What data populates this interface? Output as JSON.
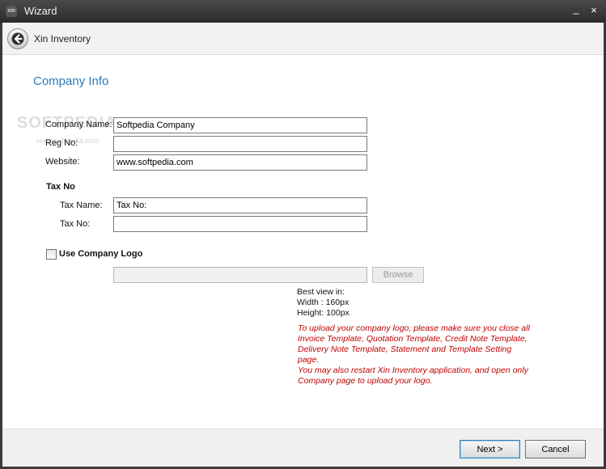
{
  "window": {
    "title": "Wizard",
    "app_icon_text": "xin",
    "minimize": "_",
    "close": "×"
  },
  "nav": {
    "title": "Xin Inventory"
  },
  "page": {
    "title": "Company Info",
    "watermark": "SOFTPEDIA",
    "watermark_url": "www.softpedia.com"
  },
  "form": {
    "company_name": {
      "label": "Company Name:",
      "value": "Softpedia Company"
    },
    "reg_no": {
      "label": "Reg No:",
      "value": ""
    },
    "website": {
      "label": "Website:",
      "value": "www.softpedia.com"
    },
    "tax_section": "Tax No",
    "tax_name": {
      "label": "Tax Name:",
      "value": "Tax No:"
    },
    "tax_no": {
      "label": "Tax No:",
      "value": ""
    },
    "use_logo": {
      "label": "Use Company Logo",
      "checked": false
    },
    "logo_path": {
      "value": ""
    },
    "browse_label": "Browse"
  },
  "info": {
    "best_view": "Best view in:",
    "width": "Width : 160px",
    "height": "Height: 100px"
  },
  "warning": {
    "line1": "To upload your company logo, please make sure you close all Invoice Template, Quotation Template, Credit Note Template, Delivery Note Template, Statement and Template Setting page.",
    "line2": "You may also restart Xin Inventory application, and open only Company page to upload your logo."
  },
  "footer": {
    "next_label": "Next >",
    "cancel_label": "Cancel"
  },
  "colors": {
    "title_blue": "#2a7ab8",
    "warning_red": "#c00000",
    "titlebar": "#2b2b2b"
  }
}
